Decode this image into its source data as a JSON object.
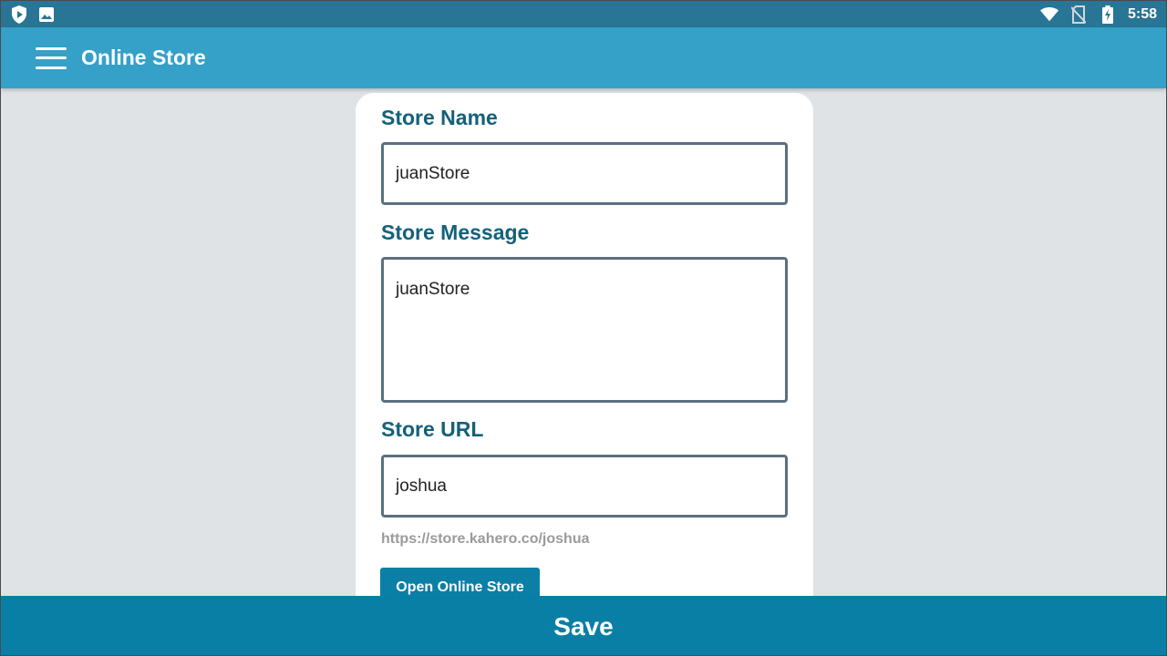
{
  "status_bar": {
    "time": "5:58",
    "left_icons": [
      "shield-play-icon",
      "image-icon"
    ],
    "right_icons": [
      "wifi-icon",
      "no-sim-icon",
      "battery-charging-icon"
    ]
  },
  "app_bar": {
    "title": "Online Store",
    "menu_icon": "hamburger-menu-icon"
  },
  "form": {
    "store_name": {
      "label": "Store Name",
      "value": "juanStore"
    },
    "store_message": {
      "label": "Store Message",
      "value": "juanStore"
    },
    "store_url": {
      "label": "Store URL",
      "value": "joshua"
    },
    "url_preview": "https://store.kahero.co/joshua",
    "open_button": "Open Online Store"
  },
  "save_button": "Save",
  "colors": {
    "status_bar": "#287595",
    "app_bar": "#35a0c8",
    "label": "#13617a",
    "input_border": "#5a7080",
    "primary_button": "#0b7fa6",
    "background": "#dfe3e6"
  }
}
